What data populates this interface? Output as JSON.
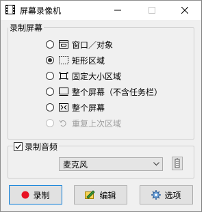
{
  "window": {
    "title": "屏幕录像机",
    "minimize": "—",
    "maximize": "☐",
    "close": "✕"
  },
  "screen_group": {
    "label": "录制屏幕",
    "options": [
      {
        "label": "窗口／对象",
        "icon": "window-icon",
        "checked": false,
        "disabled": false
      },
      {
        "label": "矩形区域",
        "icon": "dashed-rectangle-icon",
        "checked": true,
        "disabled": false
      },
      {
        "label": "固定大小区域",
        "icon": "fixed-size-region-icon",
        "checked": false,
        "disabled": false
      },
      {
        "label": "整个屏幕（不含任务栏）",
        "icon": "screen-without-taskbar-icon",
        "checked": false,
        "disabled": false
      },
      {
        "label": "整个屏幕",
        "icon": "full-screen-icon",
        "checked": false,
        "disabled": false
      },
      {
        "label": "重复上次区域",
        "icon": "repeat-icon",
        "checked": false,
        "disabled": true
      }
    ]
  },
  "audio_group": {
    "label": "录制音频",
    "checked": true,
    "device": "麦克风",
    "device_button_icon": "audio-device-settings-icon"
  },
  "buttons": {
    "record": "录制",
    "edit": "编辑",
    "options": "选项"
  },
  "colors": {
    "record_dot": "#e81123",
    "focus_border": "#0078d7",
    "window_bg": "#f0f0f0"
  }
}
